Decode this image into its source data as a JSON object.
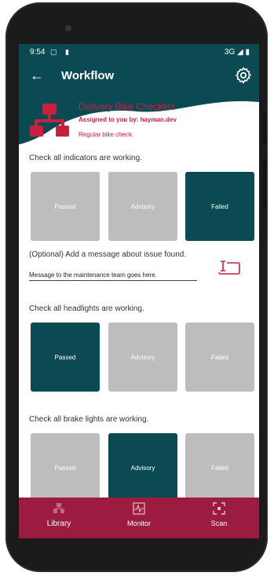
{
  "status_bar": {
    "time": "9:54",
    "left_icons": "▢ ▮",
    "right_text": "3G ◢ ▮"
  },
  "app_bar": {
    "back_icon": "back-arrow-icon",
    "title": "Workflow",
    "settings_icon": "gear-icon"
  },
  "header": {
    "title": "Delivery Bike Checklist",
    "assigned": "Assigned to you by: hayman.dev",
    "note": "Regular bike check.",
    "icon": "org-chart-icon"
  },
  "checks": [
    {
      "question": "Check all indicators are working.",
      "options": [
        "Passed",
        "Advisory",
        "Failed"
      ],
      "selected": "Failed"
    },
    {
      "question": "Check all headlights are working.",
      "options": [
        "Passed",
        "Advisory",
        "Failed"
      ],
      "selected": "Passed"
    },
    {
      "question": "Check all brake lights are working.",
      "options": [
        "Passed",
        "Advisory",
        "Failed"
      ],
      "selected": "Advisory"
    }
  ],
  "message": {
    "label": "(Optional) Add a message about issue found.",
    "value": "Message to the maintenance team goes here.",
    "icon": "text-field-icon"
  },
  "bottom_nav": [
    {
      "label": "Library",
      "icon": "library-icon"
    },
    {
      "label": "Monitor",
      "icon": "monitor-icon"
    },
    {
      "label": "Scan",
      "icon": "scan-icon"
    }
  ],
  "colors": {
    "primary": "#0b4a52",
    "accent": "#c8203f",
    "nav": "#9b1c40",
    "option_off": "#bdbdbd"
  }
}
